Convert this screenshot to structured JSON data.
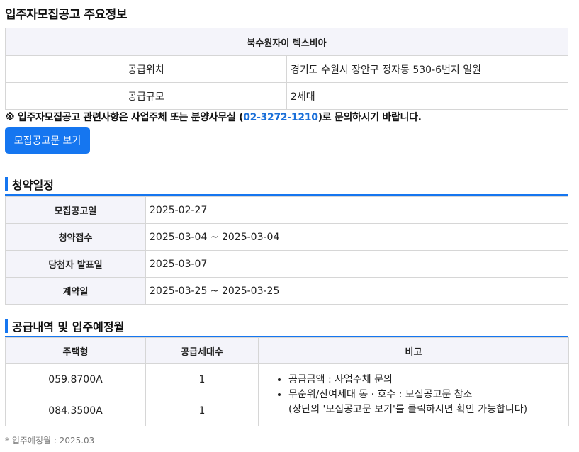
{
  "page": {
    "title": "입주자모집공고 주요정보"
  },
  "info": {
    "complex_name": "북수원자이 렉스비아",
    "rows": [
      {
        "label": "공급위치",
        "value": "경기도 수원시 장안구 정자동 530-6번지 일원"
      },
      {
        "label": "공급규모",
        "value": "2세대"
      }
    ]
  },
  "notice": {
    "prefix": "※ 입주자모집공고 관련사항은 사업주체 또는 분양사무실 (",
    "phone": "02-3272-1210",
    "suffix": ")로 문의하시기 바랍니다."
  },
  "button": {
    "view_notice_label": "모집공고문 보기"
  },
  "schedule": {
    "section_title": "청약일정",
    "rows": [
      {
        "label": "모집공고일",
        "value": "2025-02-27"
      },
      {
        "label": "청약접수",
        "value": "2025-03-04 ~ 2025-03-04"
      },
      {
        "label": "당첨자 발표일",
        "value": "2025-03-07"
      },
      {
        "label": "계약일",
        "value": "2025-03-25 ~ 2025-03-25"
      }
    ]
  },
  "supply": {
    "section_title": "공급내역 및 입주예정월",
    "headers": [
      "주택형",
      "공급세대수",
      "비고"
    ],
    "rows": [
      {
        "type": "059.8700A",
        "count": "1"
      },
      {
        "type": "084.3500A",
        "count": "1"
      }
    ],
    "notes": [
      "공급금액 : 사업주체 문의",
      "무순위/잔여세대 동 · 호수 : 모집공고문 참조"
    ],
    "notes_extra": "(상단의 '모집공고문 보기'를 클릭하시면 확인 가능합니다)"
  },
  "footnote": "* 입주예정월 : 2025.03",
  "colors": {
    "accent": "#1576f0",
    "phone": "#1a6fd9",
    "header_bg": "#f4f4fa"
  }
}
